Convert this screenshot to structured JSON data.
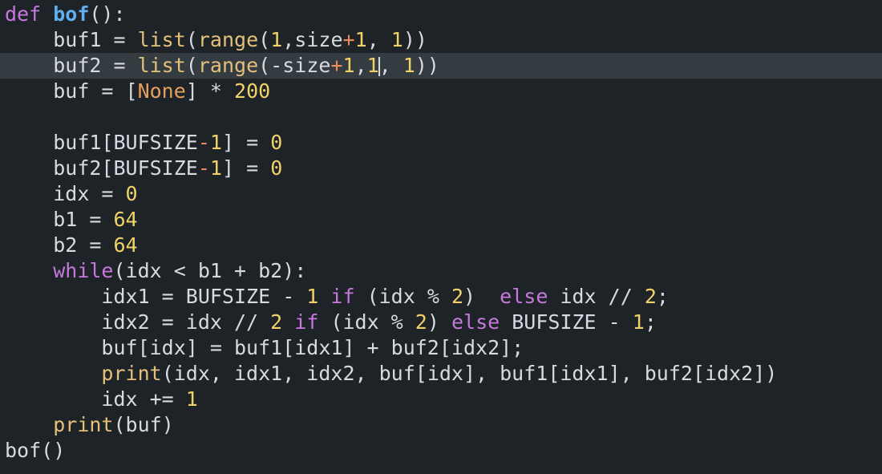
{
  "editor": {
    "current_line_index": 2,
    "lines": [
      {
        "indent": "",
        "tokens": [
          {
            "t": "def",
            "c": "kw"
          },
          {
            "t": " ",
            "c": "plain"
          },
          {
            "t": "bof",
            "c": "fn"
          },
          {
            "t": "():",
            "c": "plain"
          }
        ]
      },
      {
        "indent": "    ",
        "tokens": [
          {
            "t": "buf1 = ",
            "c": "plain"
          },
          {
            "t": "list",
            "c": "bi"
          },
          {
            "t": "(",
            "c": "plain"
          },
          {
            "t": "range",
            "c": "bi"
          },
          {
            "t": "(",
            "c": "plain"
          },
          {
            "t": "1",
            "c": "num"
          },
          {
            "t": ",size",
            "c": "plain"
          },
          {
            "t": "+",
            "c": "op"
          },
          {
            "t": "1",
            "c": "num"
          },
          {
            "t": ", ",
            "c": "plain"
          },
          {
            "t": "1",
            "c": "num"
          },
          {
            "t": "))",
            "c": "plain"
          }
        ]
      },
      {
        "indent": "    ",
        "cursor_after_token": 9,
        "tokens": [
          {
            "t": "buf2 = ",
            "c": "plain"
          },
          {
            "t": "list",
            "c": "bi"
          },
          {
            "t": "(",
            "c": "plain"
          },
          {
            "t": "range",
            "c": "bi"
          },
          {
            "t": "(-size",
            "c": "plain"
          },
          {
            "t": "+",
            "c": "op"
          },
          {
            "t": "1",
            "c": "num"
          },
          {
            "t": ",",
            "c": "plain"
          },
          {
            "t": "1",
            "c": "num"
          },
          {
            "t": "",
            "c": "plain"
          },
          {
            "t": ", ",
            "c": "plain"
          },
          {
            "t": "1",
            "c": "num"
          },
          {
            "t": "))",
            "c": "plain"
          }
        ]
      },
      {
        "indent": "    ",
        "tokens": [
          {
            "t": "buf = [",
            "c": "plain"
          },
          {
            "t": "None",
            "c": "const"
          },
          {
            "t": "] * ",
            "c": "plain"
          },
          {
            "t": "200",
            "c": "num"
          }
        ]
      },
      {
        "indent": "",
        "tokens": []
      },
      {
        "indent": "    ",
        "tokens": [
          {
            "t": "buf1[BUFSIZE",
            "c": "plain"
          },
          {
            "t": "-",
            "c": "op"
          },
          {
            "t": "1",
            "c": "num"
          },
          {
            "t": "] = ",
            "c": "plain"
          },
          {
            "t": "0",
            "c": "num"
          }
        ]
      },
      {
        "indent": "    ",
        "tokens": [
          {
            "t": "buf2[BUFSIZE",
            "c": "plain"
          },
          {
            "t": "-",
            "c": "op"
          },
          {
            "t": "1",
            "c": "num"
          },
          {
            "t": "] = ",
            "c": "plain"
          },
          {
            "t": "0",
            "c": "num"
          }
        ]
      },
      {
        "indent": "    ",
        "tokens": [
          {
            "t": "idx = ",
            "c": "plain"
          },
          {
            "t": "0",
            "c": "num"
          }
        ]
      },
      {
        "indent": "    ",
        "tokens": [
          {
            "t": "b1 = ",
            "c": "plain"
          },
          {
            "t": "64",
            "c": "num"
          }
        ]
      },
      {
        "indent": "    ",
        "tokens": [
          {
            "t": "b2 = ",
            "c": "plain"
          },
          {
            "t": "64",
            "c": "num"
          }
        ]
      },
      {
        "indent": "    ",
        "tokens": [
          {
            "t": "while",
            "c": "kw"
          },
          {
            "t": "(idx < b1 + b2):",
            "c": "plain"
          }
        ]
      },
      {
        "indent": "        ",
        "tokens": [
          {
            "t": "idx1 = BUFSIZE - ",
            "c": "plain"
          },
          {
            "t": "1",
            "c": "num"
          },
          {
            "t": " ",
            "c": "plain"
          },
          {
            "t": "if",
            "c": "kw"
          },
          {
            "t": " (idx % ",
            "c": "plain"
          },
          {
            "t": "2",
            "c": "num"
          },
          {
            "t": ")  ",
            "c": "plain"
          },
          {
            "t": "else",
            "c": "kw"
          },
          {
            "t": " idx // ",
            "c": "plain"
          },
          {
            "t": "2",
            "c": "num"
          },
          {
            "t": ";",
            "c": "plain"
          }
        ]
      },
      {
        "indent": "        ",
        "tokens": [
          {
            "t": "idx2 = idx // ",
            "c": "plain"
          },
          {
            "t": "2",
            "c": "num"
          },
          {
            "t": " ",
            "c": "plain"
          },
          {
            "t": "if",
            "c": "kw"
          },
          {
            "t": " (idx % ",
            "c": "plain"
          },
          {
            "t": "2",
            "c": "num"
          },
          {
            "t": ") ",
            "c": "plain"
          },
          {
            "t": "else",
            "c": "kw"
          },
          {
            "t": " BUFSIZE - ",
            "c": "plain"
          },
          {
            "t": "1",
            "c": "num"
          },
          {
            "t": ";",
            "c": "plain"
          }
        ]
      },
      {
        "indent": "        ",
        "tokens": [
          {
            "t": "buf[idx] = buf1[idx1] + buf2[idx2];",
            "c": "plain"
          }
        ]
      },
      {
        "indent": "        ",
        "tokens": [
          {
            "t": "print",
            "c": "bi"
          },
          {
            "t": "(idx, idx1, idx2, buf[idx], buf1[idx1], buf2[idx2])",
            "c": "plain"
          }
        ]
      },
      {
        "indent": "        ",
        "tokens": [
          {
            "t": "idx += ",
            "c": "plain"
          },
          {
            "t": "1",
            "c": "num"
          }
        ]
      },
      {
        "indent": "    ",
        "tokens": [
          {
            "t": "print",
            "c": "bi"
          },
          {
            "t": "(buf)",
            "c": "plain"
          }
        ]
      },
      {
        "indent": "",
        "tokens": [
          {
            "t": "bof()",
            "c": "plain"
          }
        ]
      }
    ]
  },
  "colors": {
    "background": "#1e2327",
    "current_line": "#343b41",
    "keyword": "#c678dd",
    "function_name": "#61afef",
    "builtin": "#e5c07b",
    "number": "#f1d26a",
    "operator": "#f08a5d",
    "constant": "#e5a05b",
    "text": "#d7dae0"
  }
}
